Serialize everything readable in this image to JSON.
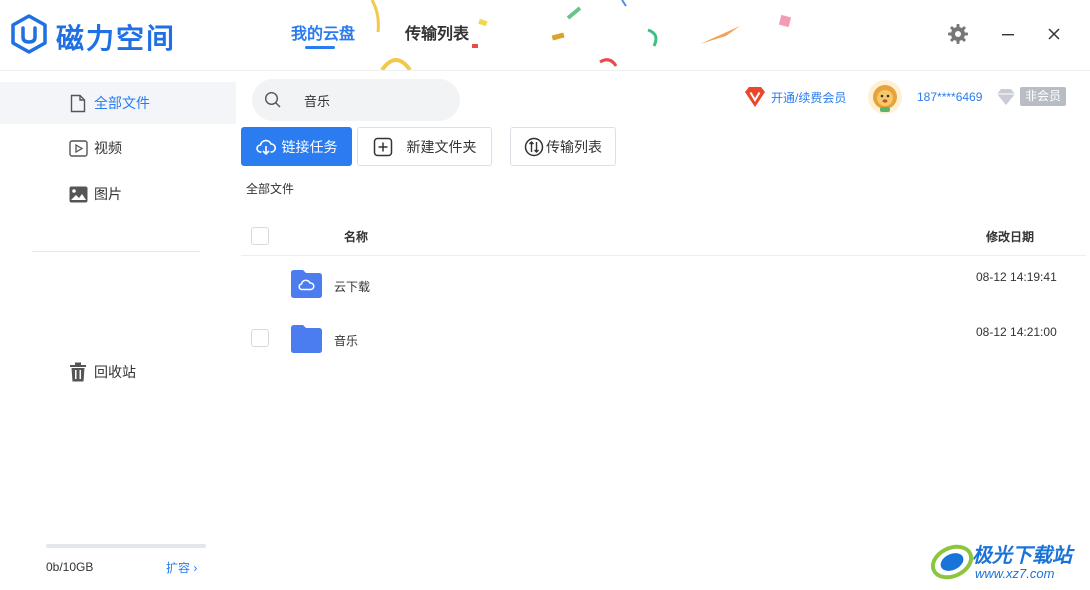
{
  "app": {
    "title": "磁力空间"
  },
  "nav": {
    "tabs": [
      {
        "label": "我的云盘",
        "active": true
      },
      {
        "label": "传输列表",
        "active": false
      }
    ]
  },
  "sidebar": {
    "items": [
      {
        "label": "全部文件",
        "icon": "file-icon",
        "active": true
      },
      {
        "label": "视频",
        "icon": "video-icon"
      },
      {
        "label": "图片",
        "icon": "image-icon"
      }
    ],
    "trash_label": "回收站",
    "storage": {
      "used_text": "0b/10GB",
      "used_fraction": 0,
      "expand_label": "扩容"
    }
  },
  "search": {
    "value": "音乐"
  },
  "account": {
    "vip_label": "开通/续费会员",
    "phone": "187****6469",
    "member_status": "非会员"
  },
  "toolbar": {
    "link_task_label": "链接任务",
    "new_folder_label": "新建文件夹",
    "transfer_list_label": "传输列表"
  },
  "breadcrumb": "全部文件",
  "table": {
    "headers": {
      "name": "名称",
      "date": "修改日期"
    },
    "rows": [
      {
        "name": "云下载",
        "date": "08-12 14:19:41",
        "type": "cloud-folder"
      },
      {
        "name": "音乐",
        "date": "08-12 14:21:00",
        "type": "folder"
      }
    ]
  },
  "watermark": {
    "title": "极光下载站",
    "url": "www.xz7.com"
  },
  "colors": {
    "accent": "#2a7cf0",
    "logo": "#1f6fe5",
    "vip": "#e8472a",
    "badge": "#b8bcc4"
  }
}
